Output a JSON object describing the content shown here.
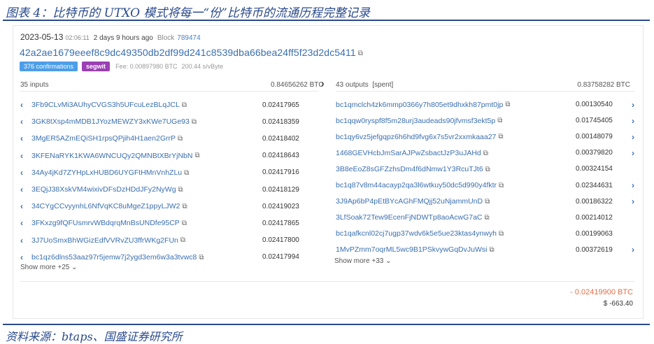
{
  "figure": {
    "caption": "图表 4：比特币的 UTXO 模式将每一“份”比特币的流通历程完整记录",
    "source": "资料来源：btaps、国盛证券研究所"
  },
  "tx": {
    "date": "2023-05-13",
    "time": "02:06:11",
    "ago": "2 days 9 hours ago",
    "block_label": "Block",
    "block_number": "789474",
    "txid": "42a2ae1679eeef8c9dc49350db2df99d241c8539dba66bea24ff5f23d2dc5411",
    "confirmations": "376 confirmations",
    "segwit": "segwit",
    "fee": "Fee: 0.00897980 BTC",
    "fee_rate": "200.44 s/vByte"
  },
  "inputs": {
    "header": "35 inputs",
    "total": "0.84656262 BTC",
    "show_more": "Show more +25 ⌄",
    "items": [
      {
        "address": "3Fb9CLvMi3AUhyCVGS3h5UFcuLezBLqJCL",
        "amount": "0.02417965"
      },
      {
        "address": "3GK8tXsp4mMDB1JYozMEWZY3xKWe7UGe93",
        "amount": "0.02418359"
      },
      {
        "address": "3MgER5AZmEQiSH1rpsQPjih4H1aen2GrrP",
        "amount": "0.02418402"
      },
      {
        "address": "3KFENaRYK1KWA6WNCUQy2QMNBtXBrYjNbN",
        "amount": "0.02418643"
      },
      {
        "address": "34Ay4jKd7ZYHpLxHUBD6UYGFtHMnVnhZLu",
        "amount": "0.02417916"
      },
      {
        "address": "3EQjJ38XskVM4wixivDFsDzHDdJFy2NyWg",
        "amount": "0.02418129"
      },
      {
        "address": "34CYgCCvyynhL6NfVqKC8uMgeZ1ppyLJW2",
        "amount": "0.02419023"
      },
      {
        "address": "3FKxzg9fQFUsmrvWBdqrqMnBsUNDfe95CP",
        "amount": "0.02417865"
      },
      {
        "address": "3J7UoSmxBhWGizEdfVVRvZU3ffrWKg2FUn",
        "amount": "0.02417800"
      },
      {
        "address": "bc1qz6dlns53aaz97r5jemw7j2ygd3em6w3a3tvwc8",
        "amount": "0.02417994"
      }
    ]
  },
  "outputs": {
    "header": "43 outputs",
    "spent_tag": "[spent]",
    "total": "0.83758282 BTC",
    "show_more": "Show more +33 ⌄",
    "items": [
      {
        "address": "bc1qmclch4zk6mmp0366y7h805et9dhxkh87pmt0jp",
        "amount": "0.00130540",
        "arrow": true
      },
      {
        "address": "bc1qqw0ryspf8f5m28urj3audeads90jfvmsf3ekt5p",
        "amount": "0.01745405",
        "arrow": true
      },
      {
        "address": "bc1qy6vz5jefgqpz6h6hd9fvg6x7s5vr2xxmkaaa27",
        "amount": "0.00148079",
        "arrow": true
      },
      {
        "address": "1468GEVHcbJmSarAJPwZsbactJzP3uJAHd",
        "amount": "0.00379820",
        "arrow": true
      },
      {
        "address": "3B8eEoZ8sGFZzhsDm4f6dNmw1Y3RcuTJt6",
        "amount": "0.00324154",
        "arrow": false
      },
      {
        "address": "bc1q87v8m44acayp2qa3l6wtkuy50dc5d990y4fktr",
        "amount": "0.02344631",
        "arrow": true
      },
      {
        "address": "3J9Ap6bP4pEtBYcAGhFMQjj52uNjammUnD",
        "amount": "0.00186322",
        "arrow": true
      },
      {
        "address": "3LfSoak72Tew9EcenFjNDWTp8aoAcwG7aC",
        "amount": "0.00214012",
        "arrow": false
      },
      {
        "address": "bc1qafkcnl02cj7ugp37wdv6k5e5ue23ktas4ynwyh",
        "amount": "0.00199063",
        "arrow": false
      },
      {
        "address": "1MvPZmm7oqrML5wc9B1PSkvywGqDvJuWsi",
        "amount": "0.00372619",
        "arrow": true
      }
    ]
  },
  "footer": {
    "btc_delta": "- 0.02419900 BTC",
    "usd": "$ -663.40"
  },
  "colors": {
    "link": "#3a6fb0",
    "confirmations_badge": "#4c9ee8",
    "segwit_badge": "#9b3fb5",
    "negative": "#e0704a",
    "caption": "#2a4a8c"
  },
  "icons": {
    "copy": "copy-icon",
    "input_chevron": "chevron-left-icon",
    "output_chevron": "chevron-right-icon",
    "flow_arrow": "arrow-right-icon"
  }
}
